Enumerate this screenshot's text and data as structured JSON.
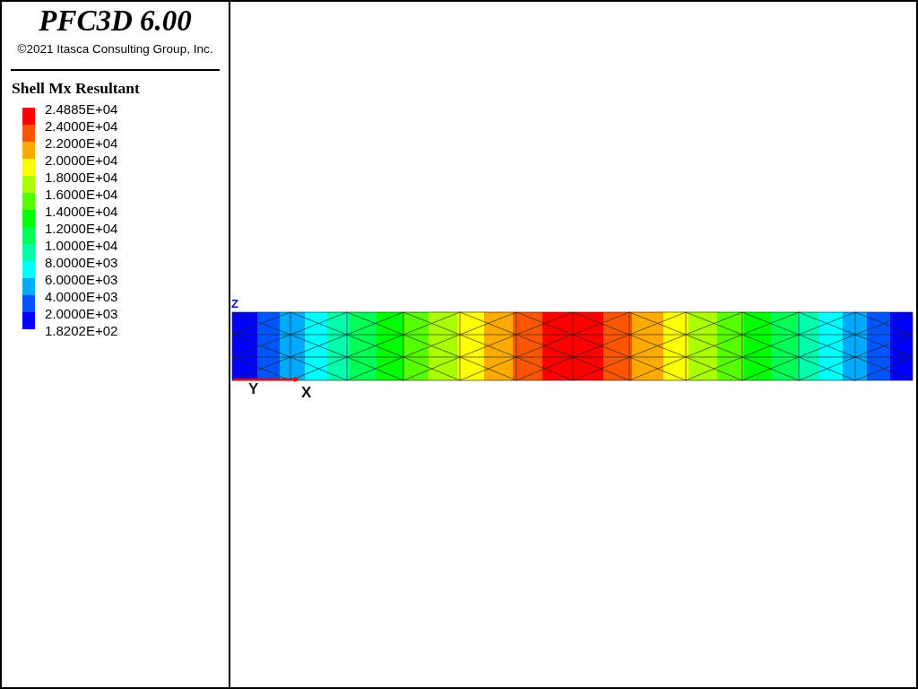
{
  "header": {
    "title": "PFC3D 6.00",
    "copyright": "©2021 Itasca Consulting Group, Inc."
  },
  "legend": {
    "title": "Shell Mx Resultant",
    "labels": [
      "2.4885E+04",
      "2.4000E+04",
      "2.2000E+04",
      "2.0000E+04",
      "1.8000E+04",
      "1.6000E+04",
      "1.4000E+04",
      "1.2000E+04",
      "1.0000E+04",
      "8.0000E+03",
      "6.0000E+03",
      "4.0000E+03",
      "2.0000E+03",
      "1.8202E+02"
    ],
    "bands": [
      {
        "color": "#ff0000"
      },
      {
        "color": "#ff5500"
      },
      {
        "color": "#ffaa00"
      },
      {
        "color": "#ffff00"
      },
      {
        "color": "#aaff00"
      },
      {
        "color": "#55ff00"
      },
      {
        "color": "#00ff00"
      },
      {
        "color": "#00ff55"
      },
      {
        "color": "#00ffaa"
      },
      {
        "color": "#00ffff"
      },
      {
        "color": "#00aaff"
      },
      {
        "color": "#0055ff"
      },
      {
        "color": "#0000ff"
      }
    ]
  },
  "axes": {
    "z": "Z",
    "y": "Y",
    "x": "X"
  }
}
